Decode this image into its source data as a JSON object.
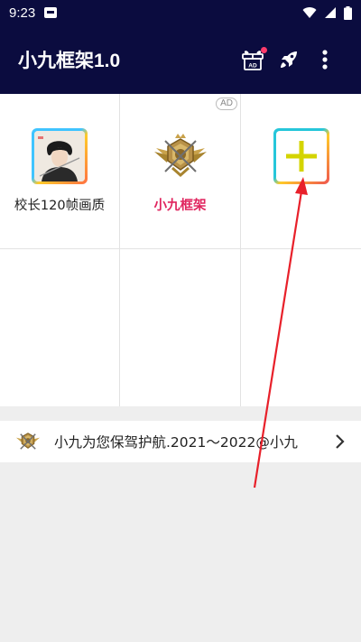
{
  "status_bar": {
    "time": "9:23"
  },
  "app_bar": {
    "title": "小九框架1.0",
    "gift_badge": "AD",
    "actions": [
      "gift-ad-icon",
      "rocket-icon",
      "more-vert-icon"
    ]
  },
  "grid": {
    "cells": [
      {
        "label": "校长120帧画质",
        "icon": "avatar-image"
      },
      {
        "label": "小九框架",
        "icon": "emblem-image",
        "badge": "AD"
      },
      {
        "label": "",
        "icon": "add-icon"
      }
    ]
  },
  "notice": {
    "text": "小九为您保驾护航.2021～2022@小九",
    "icon": "emblem-image"
  },
  "colors": {
    "app_bar": "#0b0c3f",
    "accent_pink": "#e0245e",
    "plus_yellow": "#d4d400",
    "arrow_red": "#e8202a"
  }
}
